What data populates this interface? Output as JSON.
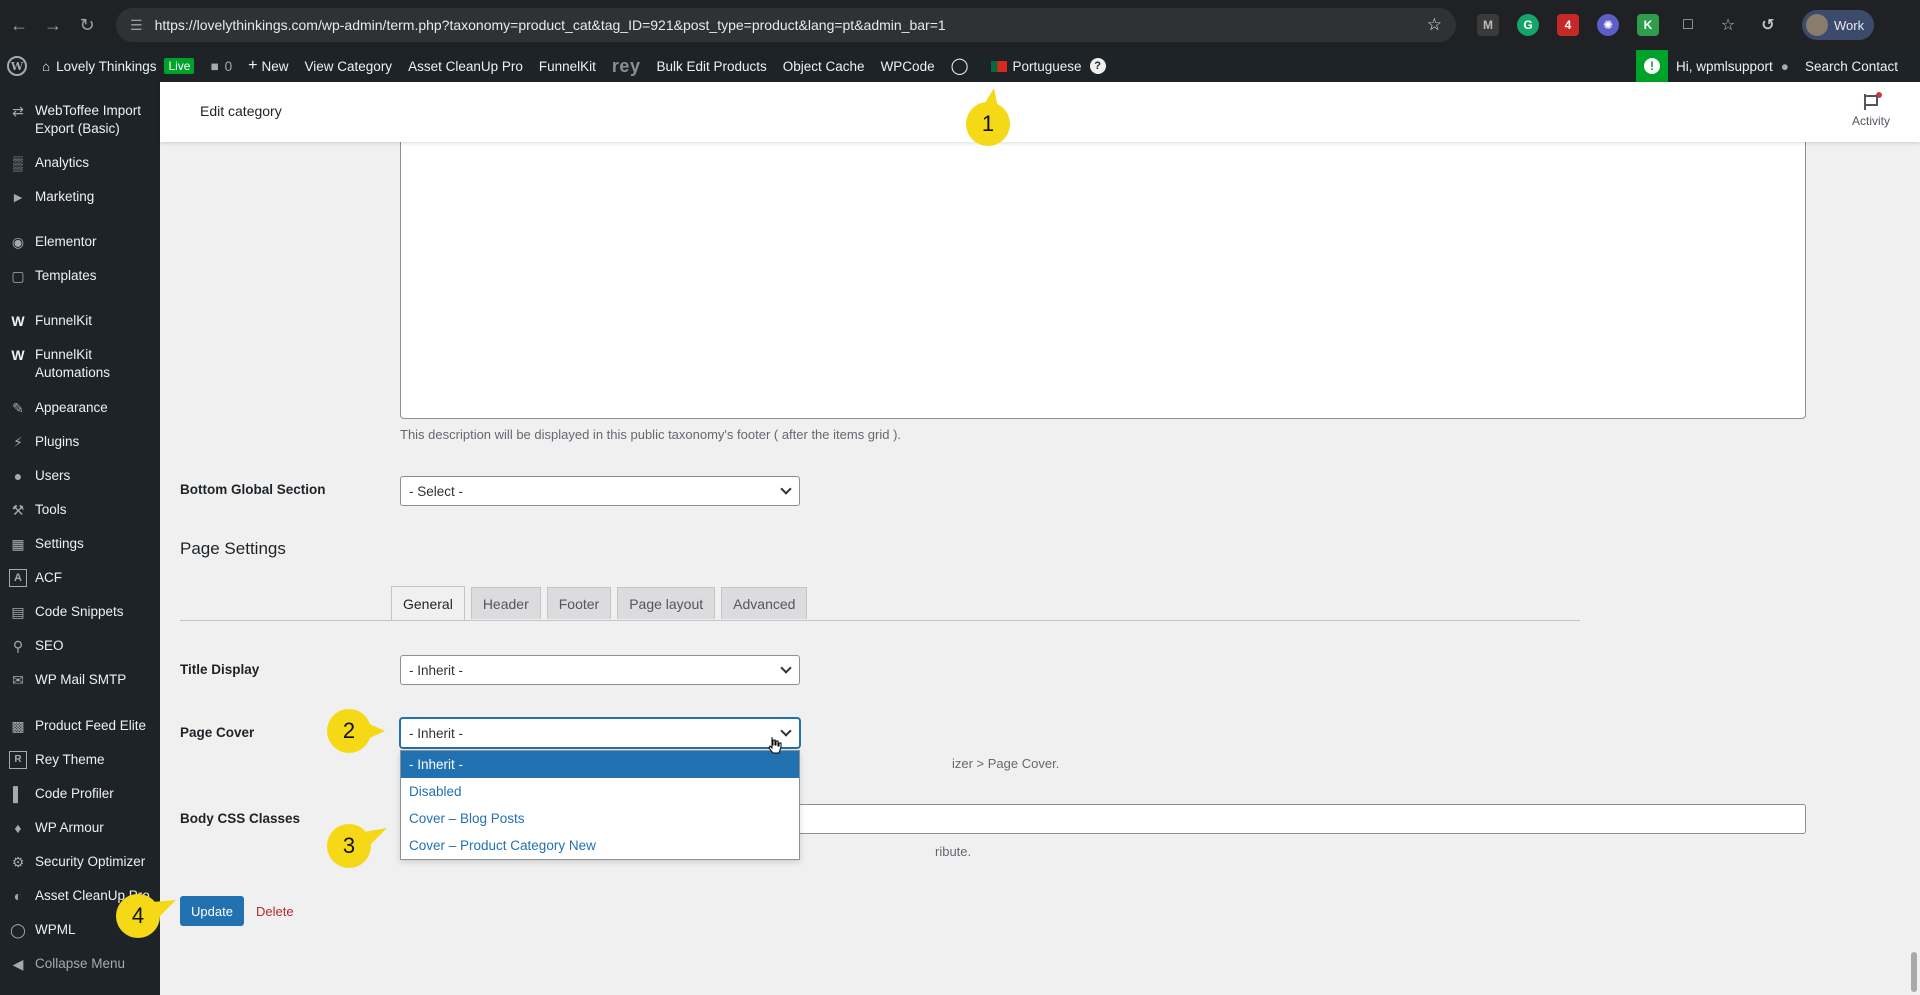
{
  "browser": {
    "url": "https://lovelythinkings.com/wp-admin/term.php?taxonomy=product_cat&tag_ID=921&post_type=product&lang=pt&admin_bar=1",
    "profile_label": "Work",
    "extension_badge": "4"
  },
  "adminbar": {
    "site_name": "Lovely Thinkings",
    "live_badge": "Live",
    "comments_count": "0",
    "new_label": "New",
    "view_category": "View Category",
    "asset_cleanup": "Asset CleanUp Pro",
    "funnelkit": "FunnelKit",
    "rey": "rey",
    "bulk_edit": "Bulk Edit Products",
    "object_cache": "Object Cache",
    "wpcode": "WPCode",
    "language": "Portuguese",
    "help_mark": "?",
    "alert_mark": "!",
    "greeting": "Hi, wpmlsupport",
    "search_contact": "Search Contact"
  },
  "sidebar": {
    "items": [
      {
        "label": "WebToffee Import Export (Basic)",
        "icon": "import-icon"
      },
      {
        "label": "Analytics",
        "icon": "bar-chart-icon"
      },
      {
        "label": "Marketing",
        "icon": "megaphone-icon"
      },
      {
        "label": "Elementor",
        "icon": "elementor-icon"
      },
      {
        "label": "Templates",
        "icon": "folder-icon"
      },
      {
        "label": "FunnelKit",
        "icon": "funnelkit-icon"
      },
      {
        "label": "FunnelKit Automations",
        "icon": "funnelkit-icon"
      },
      {
        "label": "Appearance",
        "icon": "brush-icon"
      },
      {
        "label": "Plugins",
        "icon": "plug-icon"
      },
      {
        "label": "Users",
        "icon": "user-icon"
      },
      {
        "label": "Tools",
        "icon": "wrench-icon"
      },
      {
        "label": "Settings",
        "icon": "sliders-icon"
      },
      {
        "label": "ACF",
        "icon": "acf-icon"
      },
      {
        "label": "Code Snippets",
        "icon": "code-icon"
      },
      {
        "label": "SEO",
        "icon": "search-icon"
      },
      {
        "label": "WP Mail SMTP",
        "icon": "mail-icon"
      },
      {
        "label": "Product Feed Elite",
        "icon": "feed-icon"
      },
      {
        "label": "Rey Theme",
        "icon": "rey-icon"
      },
      {
        "label": "Code Profiler",
        "icon": "profiler-icon"
      },
      {
        "label": "WP Armour",
        "icon": "shield-icon"
      },
      {
        "label": "Security Optimizer",
        "icon": "gear-icon"
      },
      {
        "label": "Asset CleanUp Pro",
        "icon": "gauge-icon"
      },
      {
        "label": "WPML",
        "icon": "wpml-icon"
      },
      {
        "label": "Collapse Menu",
        "icon": "collapse-icon"
      }
    ]
  },
  "header": {
    "title": "Edit category",
    "activity": "Activity"
  },
  "form": {
    "description_help": "This description will be displayed in this public taxonomy's footer ( after the items grid ).",
    "bottom_global_label": "Bottom Global Section",
    "bottom_global_value": "- Select -",
    "page_settings_title": "Page Settings",
    "tabs": [
      "General",
      "Header",
      "Footer",
      "Page layout",
      "Advanced"
    ],
    "title_display_label": "Title Display",
    "title_display_value": "- Inherit -",
    "page_cover_label": "Page Cover",
    "page_cover_value": "- Inherit -",
    "page_cover_help_visible": "izer > Page Cover.",
    "page_cover_options": [
      "- Inherit -",
      "Disabled",
      "Cover – Blog Posts",
      "Cover – Product Category New"
    ],
    "body_css_label": "Body CSS Classes",
    "body_css_help_visible": "ribute.",
    "update_label": "Update",
    "delete_label": "Delete"
  },
  "markers": [
    "1",
    "2",
    "3",
    "4"
  ],
  "colors": {
    "wp_blue": "#2271b1",
    "admin_dark": "#1d2327",
    "marker_yellow": "#f5d916",
    "delete_red": "#b32d2e",
    "live_green": "#00a32a"
  }
}
